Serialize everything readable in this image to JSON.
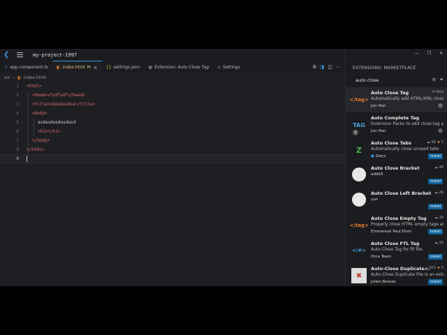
{
  "titlebar": {
    "project": "my-project-1997"
  },
  "tabs": [
    {
      "label": "app.component.ts",
      "icon": "ts-icon"
    },
    {
      "label": "index.html",
      "modified": "M",
      "icon": "html-icon"
    },
    {
      "label": "settings.json",
      "icon": "json-icon"
    },
    {
      "label": "Extension: Auto Close Tag",
      "icon": "extension-icon"
    },
    {
      "label": "Settings",
      "icon": "gear-icon"
    }
  ],
  "breadcrumb": {
    "folder": "src",
    "file": "index.html"
  },
  "editor": {
    "lines": [
      {
        "n": "1",
        "t": "<html>"
      },
      {
        "n": "2",
        "t": "<head>sfsdfsdf</head>"
      },
      {
        "n": "3",
        "t": "<title>sdasdasdsa</title>"
      },
      {
        "n": "4",
        "t": "<body>"
      },
      {
        "n": "5",
        "t": "asdasdasdasdasd"
      },
      {
        "n": "6",
        "t": "<h1></h1>"
      },
      {
        "n": "7",
        "t": "</body>"
      },
      {
        "n": "8",
        "t": "</html>"
      },
      {
        "n": "9",
        "t": ""
      }
    ]
  },
  "panel": {
    "title": "EXTENSIONS: MARKETPLACE",
    "search_value": "auto close"
  },
  "extensions": [
    {
      "name": "Auto Close Tag",
      "desc": "Automatically add HTML/XML close tag",
      "pub": "Jun Han",
      "meta": "4ms",
      "icon_text": "</tag>"
    },
    {
      "name": "Auto Complete Tag",
      "desc": "Extension Packs to add close tag and",
      "pub": "Jun Han",
      "icon_text": "TAG",
      "badge": "2"
    },
    {
      "name": "Auto Close Tabs",
      "desc": "Automatically close unused tabs",
      "pub": "Zwyx",
      "meta": "5K",
      "rating": "5",
      "icon_text": "Z",
      "action": "Install"
    },
    {
      "name": "Auto Close Bracket",
      "desc": "",
      "pub": "addd3",
      "meta": "4K",
      "action": "Install"
    },
    {
      "name": "Auto Close Left Bracket",
      "desc": "",
      "pub": "yun",
      "meta": "2K",
      "action": "Install"
    },
    {
      "name": "Auto Close Empty Tag",
      "desc": "Properly close HTML empty tags and",
      "pub": "Emmanuel Paul Elom",
      "meta": "1K",
      "icon_text": "</tag>",
      "action": "Install"
    },
    {
      "name": "Auto Close FTL Tag",
      "desc": "Auto Close Tag for ftl file.",
      "pub": "Orca Team",
      "meta": "1K",
      "icon_text": "</#>",
      "action": "Install"
    },
    {
      "name": "Auto-Close Duplicate...",
      "desc": "Auto-Close Duplicate File is an exte",
      "pub": "Julien Bessac",
      "meta": "625",
      "rating": "5",
      "action": "Install"
    }
  ]
}
